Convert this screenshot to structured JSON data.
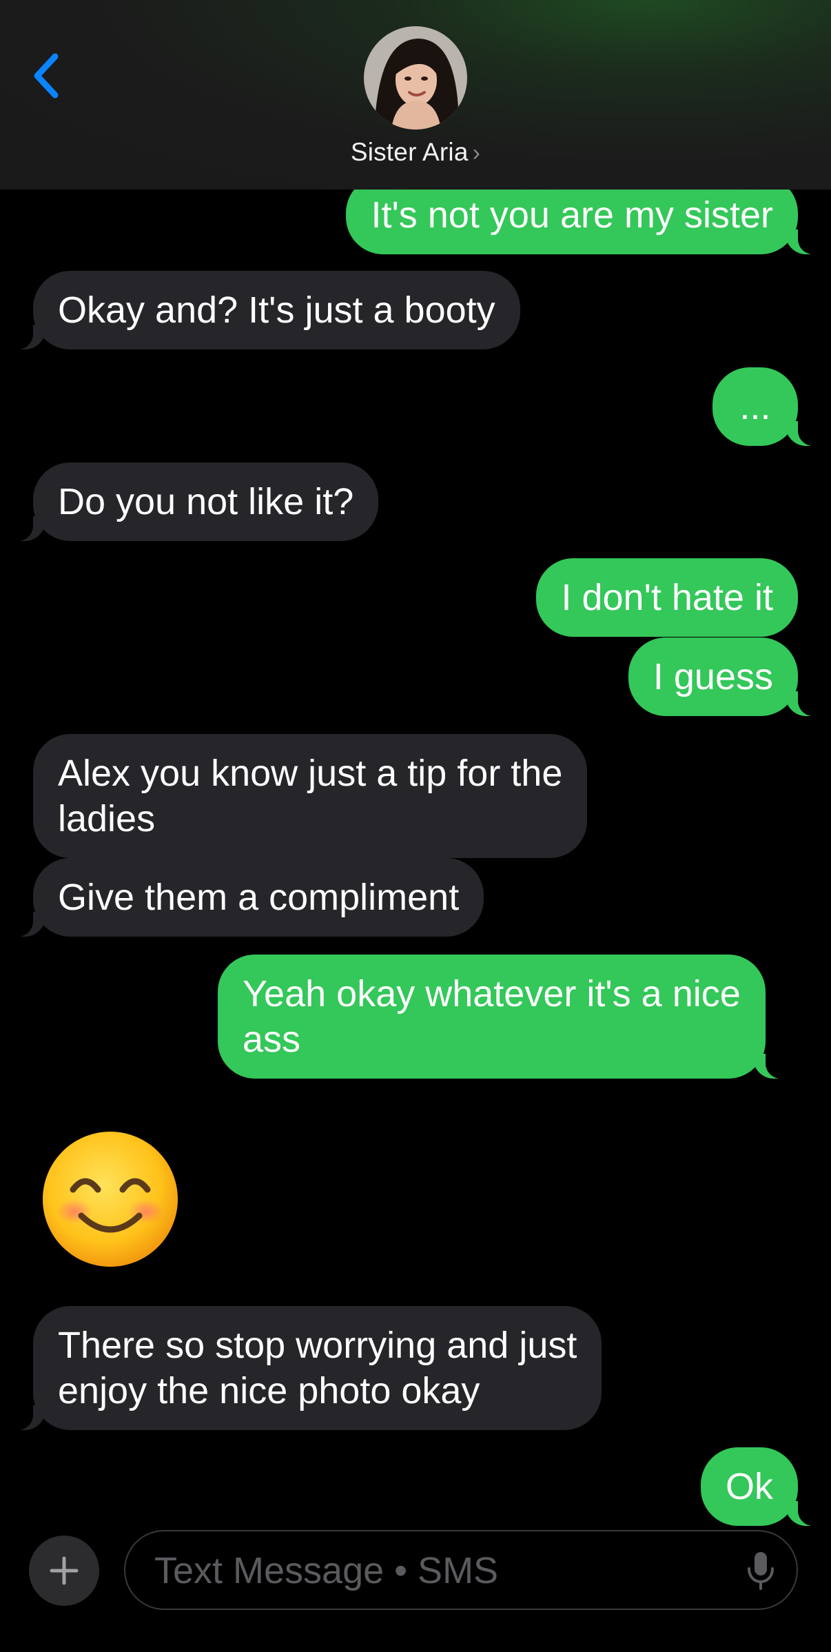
{
  "header": {
    "contact_name": "Sister Aria",
    "chevron": "›"
  },
  "messages": [
    {
      "side": "out",
      "text": "It's not you are my sister"
    },
    {
      "side": "in",
      "text": "Okay and? It's just a booty"
    },
    {
      "side": "out",
      "text": "..."
    },
    {
      "side": "in",
      "text": "Do you not like it?"
    },
    {
      "side": "out",
      "text": "I don't hate it"
    },
    {
      "side": "out",
      "text": "I guess"
    },
    {
      "side": "in",
      "text": "Alex you know just a tip for the\nladies"
    },
    {
      "side": "in",
      "text": "Give them a compliment"
    },
    {
      "side": "out",
      "text": "Yeah okay whatever it's a nice\nass"
    },
    {
      "side": "in",
      "emoji": "smiling-face-with-smiling-eyes"
    },
    {
      "side": "in",
      "text": "There so stop worrying and just\nenjoy the nice photo okay"
    },
    {
      "side": "out",
      "text": "Ok"
    }
  ],
  "composer": {
    "placeholder": "Text Message • SMS"
  },
  "colors": {
    "outgoing": "#34c759",
    "incoming": "#26252a",
    "accent": "#0a84ff"
  }
}
